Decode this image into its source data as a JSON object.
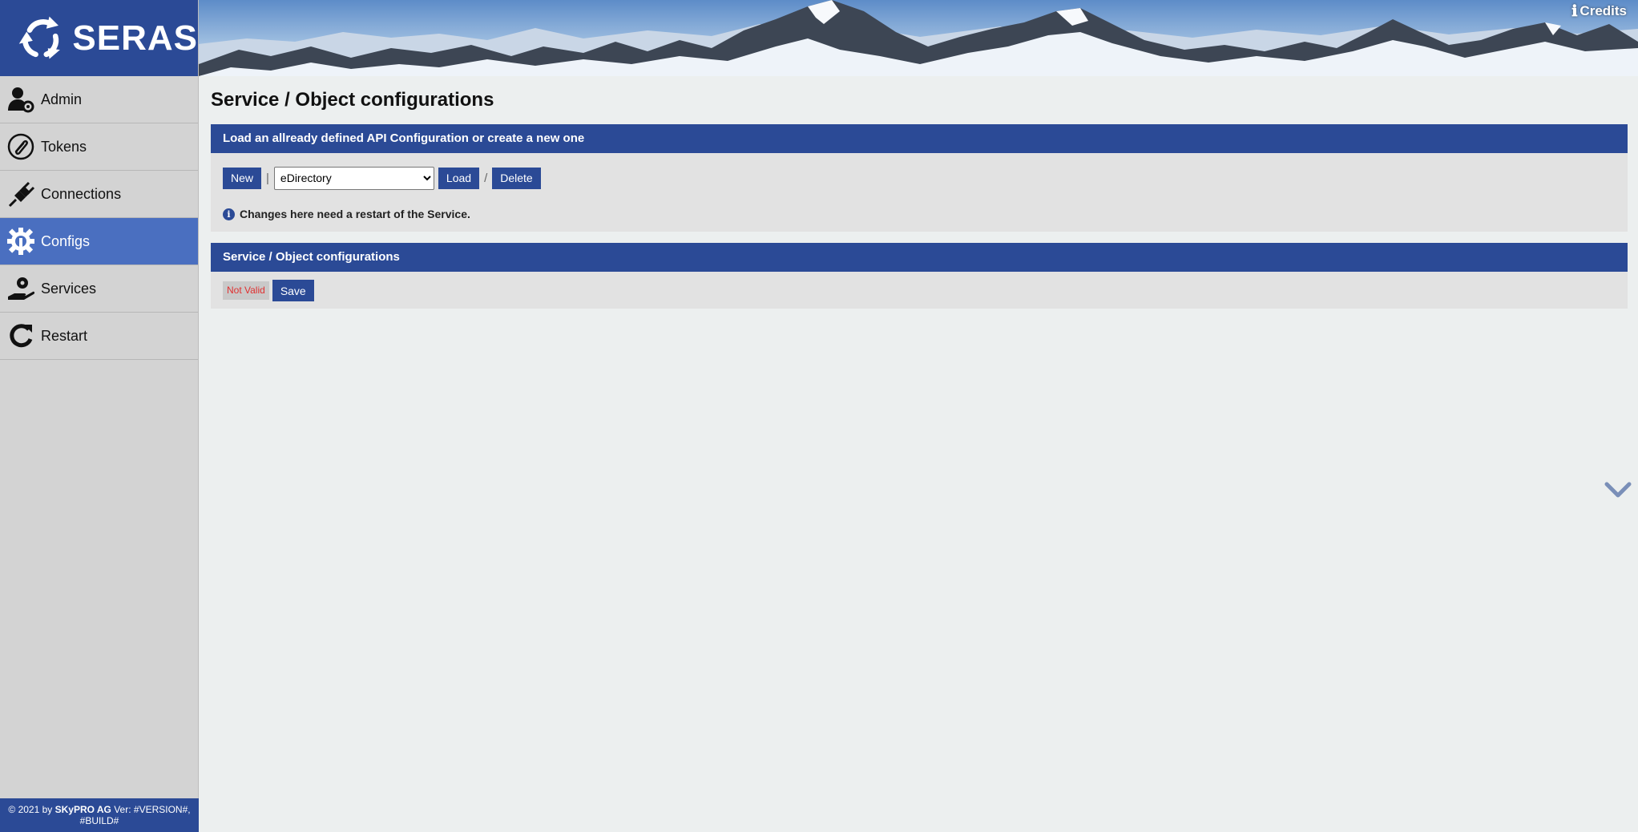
{
  "app": {
    "logo_text": "SERAS"
  },
  "header": {
    "credits_label": "Credits"
  },
  "sidebar": {
    "items": [
      {
        "label": "Admin",
        "icon": "user-gear-icon",
        "active": false
      },
      {
        "label": "Tokens",
        "icon": "paperclip-icon",
        "active": false
      },
      {
        "label": "Connections",
        "icon": "plug-icon",
        "active": false
      },
      {
        "label": "Configs",
        "icon": "gear-wrench-icon",
        "active": true
      },
      {
        "label": "Services",
        "icon": "hand-gear-icon",
        "active": false
      },
      {
        "label": "Restart",
        "icon": "restart-icon",
        "active": false
      }
    ],
    "footer": {
      "copyright_symbol": "©",
      "text_prefix": "2021 by",
      "company": "SKyPRO AG",
      "version": "Ver: #VERSION#,",
      "build": "#BUILD#"
    }
  },
  "main": {
    "title": "Service / Object configurations",
    "load_panel": {
      "heading": "Load an allready defined API Configuration or create a new one",
      "new_label": "New",
      "separator1": "|",
      "select_value": "eDirectory",
      "load_label": "Load",
      "separator2": "/",
      "delete_label": "Delete",
      "info_text": "Changes here need a restart of the Service."
    },
    "config_panel": {
      "heading": "Service / Object configurations",
      "status_badge": "Not Valid",
      "save_label": "Save"
    }
  },
  "colors": {
    "primary": "#2b4a96",
    "active_nav": "#4a6fc0",
    "sidebar_bg": "#d3d3d3",
    "page_bg": "#ecefef",
    "invalid": "#e03030"
  }
}
